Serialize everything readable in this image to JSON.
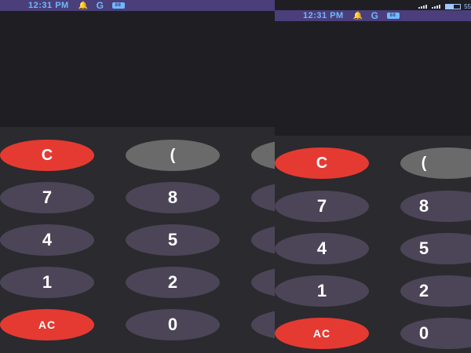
{
  "status": {
    "time": "12:31 PM",
    "network_letter": "G",
    "badge": "88",
    "battery_text": "55",
    "battery_level": 0.55
  },
  "keys": {
    "clear": "C",
    "paren": "(",
    "seven": "7",
    "eight": "8",
    "four": "4",
    "five": "5",
    "one": "1",
    "two": "2",
    "all_clear": "AC",
    "zero": "0"
  },
  "colors": {
    "status_bar": "#4a3f7a",
    "status_text": "#6fb8ff",
    "display_bg": "#1f1e22",
    "keypad_bg": "#2b2a2e",
    "number_key": "#4b4557",
    "clear_key": "#e53a32",
    "paren_key": "#6a6a6a"
  }
}
